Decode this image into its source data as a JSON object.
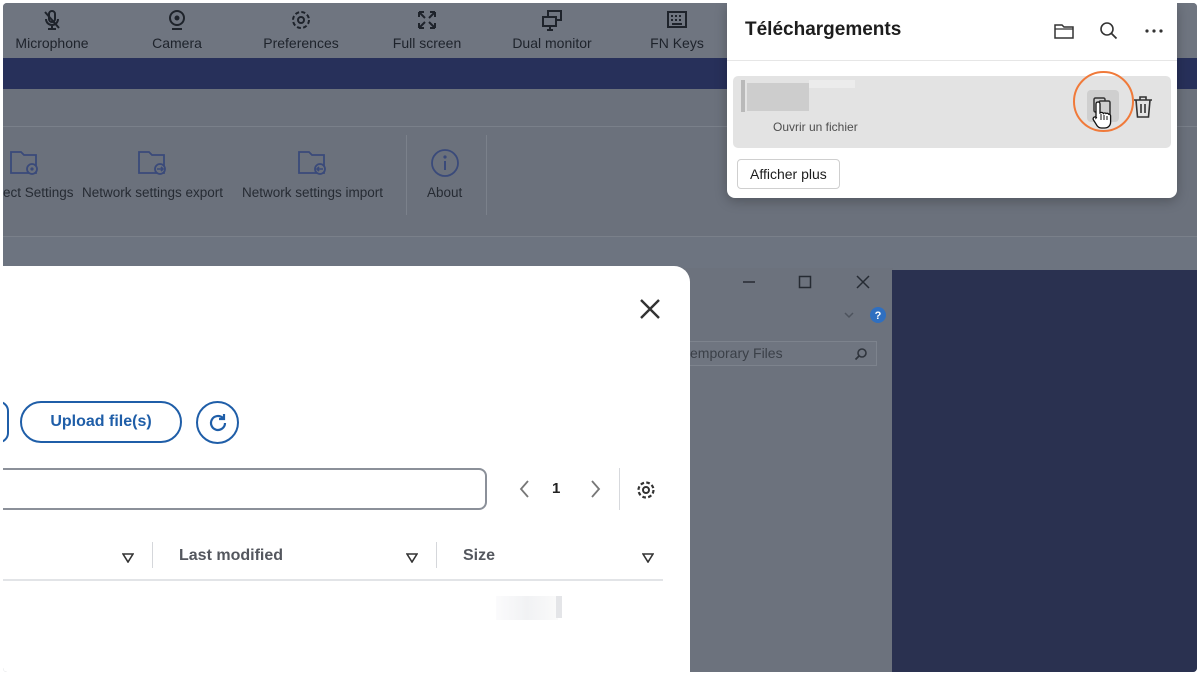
{
  "toolbar": {
    "items": [
      {
        "label": "Microphone",
        "icon": "microphone-icon"
      },
      {
        "label": "Camera",
        "icon": "camera-icon"
      },
      {
        "label": "Preferences",
        "icon": "gear-icon"
      },
      {
        "label": "Full screen",
        "icon": "fullscreen-icon"
      },
      {
        "label": "Dual monitor",
        "icon": "dual-monitor-icon"
      },
      {
        "label": "FN Keys",
        "icon": "keyboard-icon"
      }
    ]
  },
  "ribbon": {
    "items": [
      {
        "label": "ect Settings",
        "icon": "folder-gear-icon"
      },
      {
        "label": "Network settings export",
        "icon": "folder-export-icon"
      },
      {
        "label": "Network settings import",
        "icon": "folder-import-icon"
      },
      {
        "label": "About",
        "icon": "info-icon"
      }
    ]
  },
  "background_window": {
    "search_placeholder": "emporary Files"
  },
  "dialog": {
    "upload_label": "Upload file(s)",
    "filter_value": "",
    "page_number": "1",
    "columns": [
      {
        "label": "Last modified"
      },
      {
        "label": "Size"
      }
    ]
  },
  "downloads": {
    "title": "Téléchargements",
    "item_subtitle": "Ouvrir un fichier",
    "show_more_label": "Afficher plus"
  },
  "colors": {
    "accent_blue": "#1f5ea8",
    "navy_band": "#27305a",
    "highlight_orange": "#f07a3a"
  }
}
